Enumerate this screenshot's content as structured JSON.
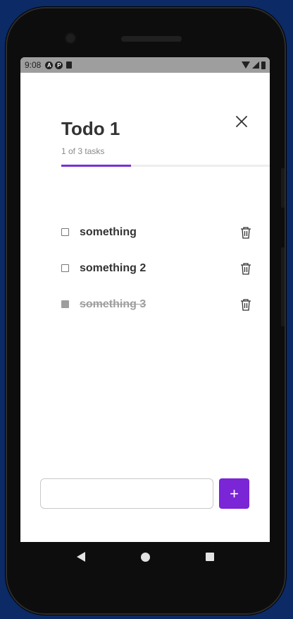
{
  "status_bar": {
    "time": "9:08",
    "icons": [
      "notification-a-icon",
      "notification-p-icon",
      "sd-card-icon",
      "wifi-icon",
      "cell-signal-icon",
      "battery-icon"
    ]
  },
  "header": {
    "title": "Todo 1",
    "subtitle": "1 of 3 tasks",
    "progress": 0.333
  },
  "tasks": [
    {
      "label": "something",
      "done": false
    },
    {
      "label": "something 2",
      "done": false
    },
    {
      "label": "something 3",
      "done": true
    }
  ],
  "composer": {
    "placeholder": "",
    "add_label": "+"
  },
  "colors": {
    "accent": "#7b2fd6",
    "done_text": "#9e9e9e",
    "title": "#333333"
  }
}
